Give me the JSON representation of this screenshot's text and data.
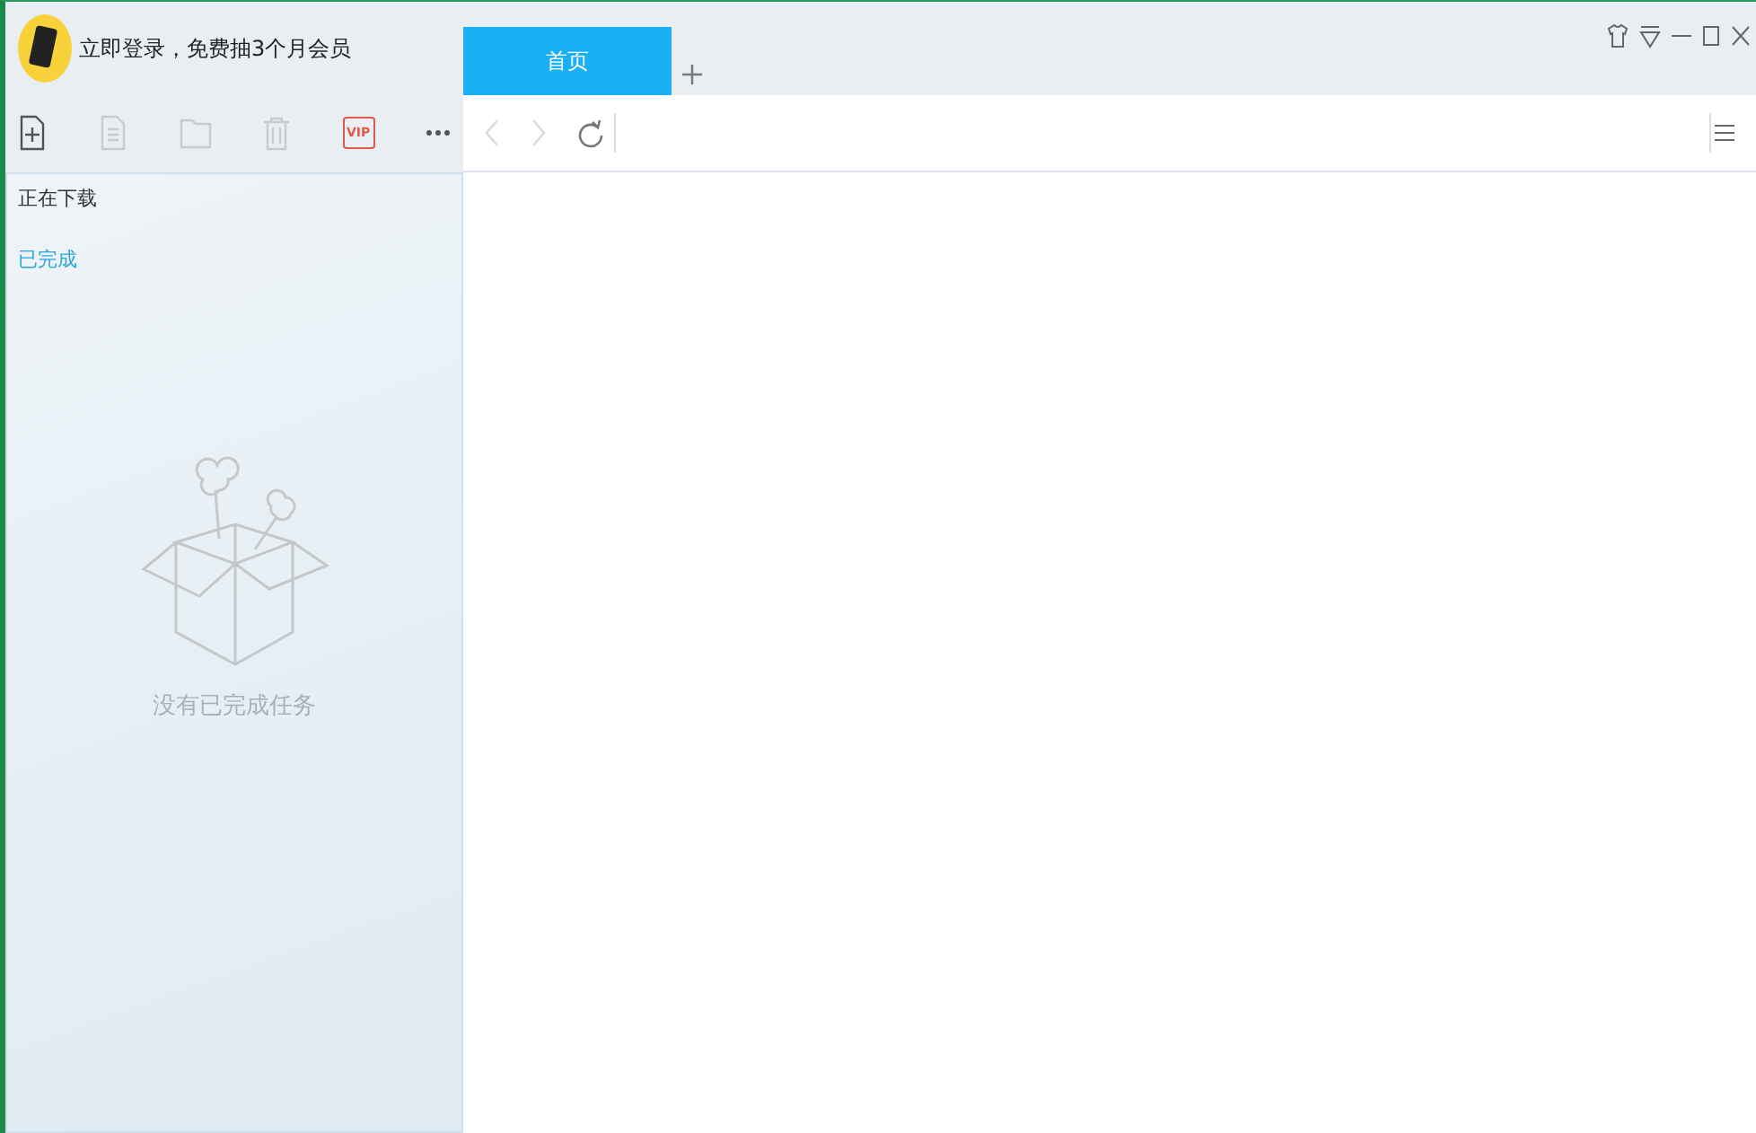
{
  "account": {
    "promo": "立即登录，免费抽3个月会员"
  },
  "toolbar": [
    {
      "kind": "new",
      "disabled": false
    },
    {
      "kind": "file",
      "disabled": true
    },
    {
      "kind": "folder",
      "disabled": true
    },
    {
      "kind": "trash",
      "disabled": true
    },
    {
      "kind": "vip",
      "disabled": false,
      "label": "VIP"
    },
    {
      "kind": "more",
      "disabled": false
    }
  ],
  "sidebar": {
    "items": [
      {
        "label": "正在下载",
        "selected": false
      },
      {
        "label": "已完成",
        "selected": true
      }
    ],
    "empty_message": "没有已完成任务"
  },
  "tabs": [
    {
      "label": "首页",
      "selected": true
    }
  ],
  "nav": {
    "back_disabled": true,
    "forward_disabled": true
  }
}
